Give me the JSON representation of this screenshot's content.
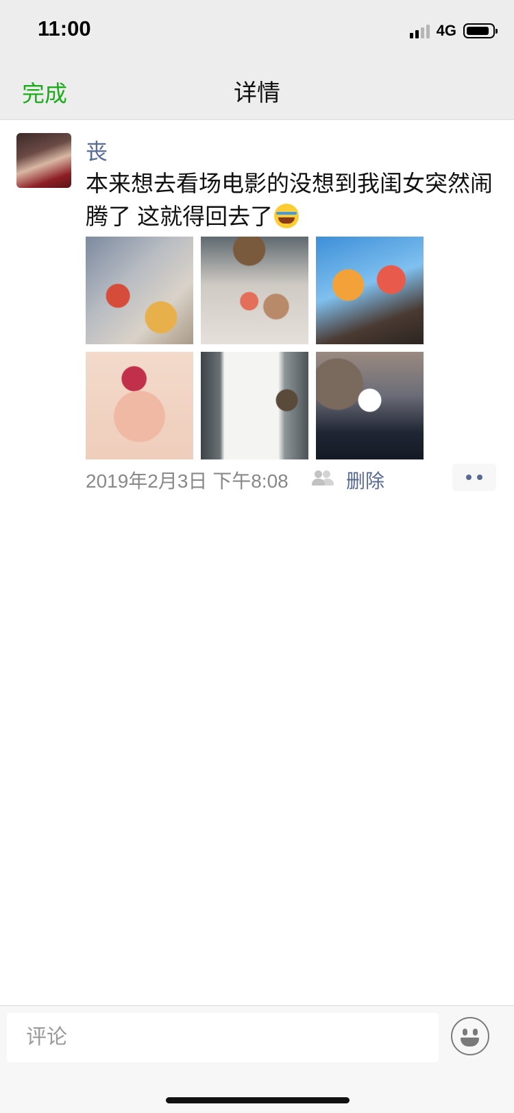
{
  "status_bar": {
    "time": "11:00",
    "network": "4G"
  },
  "nav": {
    "done_label": "完成",
    "title": "详情"
  },
  "post": {
    "username": "丧",
    "text": "本来想去看场电影的没想到我闺女突然闹腾了 这就得回去了",
    "emoji": "tears-of-joy",
    "photos": [
      {
        "label": "hotpot-restaurant-table"
      },
      {
        "label": "dinner-dishes"
      },
      {
        "label": "ice-cream-cups"
      },
      {
        "label": "paper-cut-selfie"
      },
      {
        "label": "receipt"
      },
      {
        "label": "selfie-with-sticker"
      }
    ],
    "time": "2019年2月3日 下午8:08",
    "delete_label": "删除"
  },
  "comment_bar": {
    "placeholder": "评论"
  },
  "icons": {
    "signal": "signal-bars-icon",
    "battery": "battery-icon",
    "privacy": "friends-visibility-icon",
    "more": "more-dots-icon",
    "emoji": "smiley-icon"
  },
  "colors": {
    "accent_green": "#1aad19",
    "link_blue": "#576b95",
    "bar_background": "#ededed",
    "meta_gray": "#888888"
  }
}
